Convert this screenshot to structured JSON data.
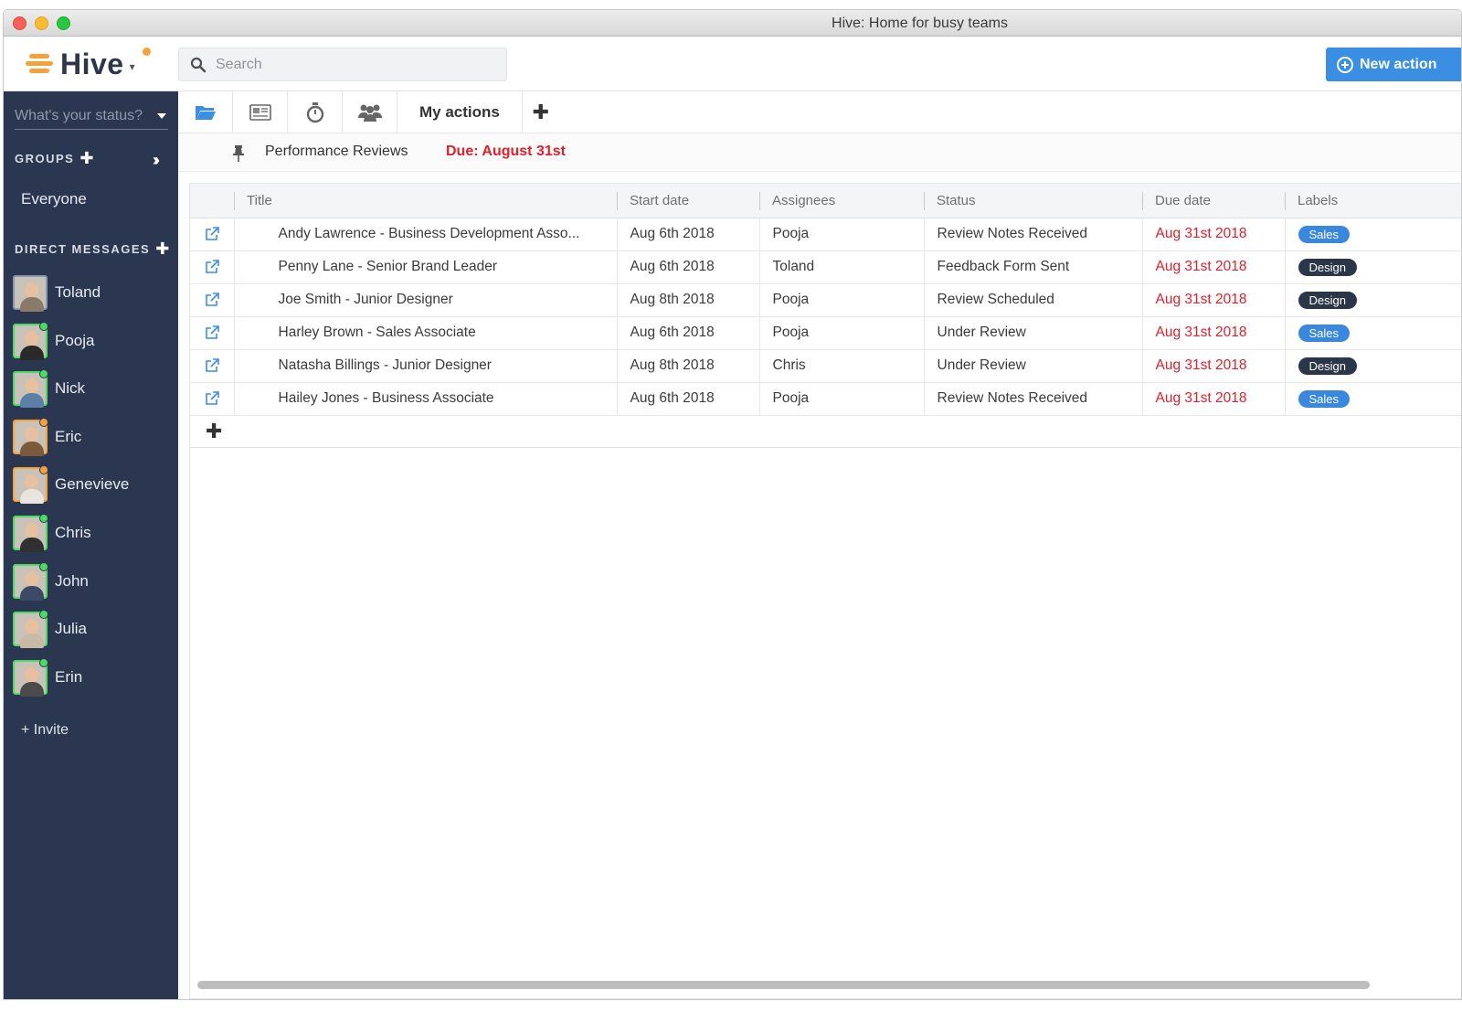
{
  "window": {
    "title": "Hive: Home for busy teams"
  },
  "app": {
    "logo_text": "Hive"
  },
  "search": {
    "placeholder": "Search"
  },
  "toolbar": {
    "new_action_label": "New action"
  },
  "sidebar": {
    "status_placeholder": "What's your status?",
    "groups_heading": "GROUPS",
    "groups": [
      {
        "label": "Everyone"
      }
    ],
    "dm_heading": "DIRECT MESSAGES",
    "direct_messages": [
      {
        "name": "Toland",
        "presence": "none",
        "shirt": "#8a7a6a"
      },
      {
        "name": "Pooja",
        "presence": "online",
        "shirt": "#2a2a2a"
      },
      {
        "name": "Nick",
        "presence": "online",
        "shirt": "#5c7fa8"
      },
      {
        "name": "Eric",
        "presence": "away",
        "shirt": "#7a5a3a"
      },
      {
        "name": "Genevieve",
        "presence": "away",
        "shirt": "#e9e4dd"
      },
      {
        "name": "Chris",
        "presence": "online",
        "shirt": "#303030"
      },
      {
        "name": "John",
        "presence": "online",
        "shirt": "#3b4a66"
      },
      {
        "name": "Julia",
        "presence": "online",
        "shirt": "#c9b9a5"
      },
      {
        "name": "Erin",
        "presence": "online",
        "shirt": "#4b4b4b"
      }
    ],
    "invite_label": "+ Invite"
  },
  "tabs": {
    "icons": [
      "folder-icon",
      "newspaper-icon",
      "timer-icon",
      "team-icon"
    ],
    "my_actions_label": "My actions"
  },
  "pinned": {
    "title": "Performance Reviews",
    "due": "Due: August 31st"
  },
  "table": {
    "columns": [
      "Title",
      "Start date",
      "Assignees",
      "Status",
      "Due date",
      "Labels"
    ],
    "rows": [
      {
        "title": "Andy Lawrence  - Business Development Asso...",
        "start": "Aug 6th 2018",
        "assignee": "Pooja",
        "status": "Review Notes Received",
        "due": "Aug 31st 2018",
        "label": "Sales"
      },
      {
        "title": "Penny Lane - Senior Brand Leader",
        "start": "Aug 6th 2018",
        "assignee": "Toland",
        "status": "Feedback Form Sent",
        "due": "Aug 31st 2018",
        "label": "Design"
      },
      {
        "title": "Joe Smith - Junior Designer",
        "start": "Aug 8th 2018",
        "assignee": "Pooja",
        "status": "Review Scheduled",
        "due": "Aug 31st 2018",
        "label": "Design"
      },
      {
        "title": "Harley Brown - Sales Associate",
        "start": "Aug 6th 2018",
        "assignee": "Pooja",
        "status": "Under Review",
        "due": "Aug 31st 2018",
        "label": "Sales"
      },
      {
        "title": "Natasha Billings - Junior Designer",
        "start": "Aug 8th 2018",
        "assignee": "Chris",
        "status": "Under Review",
        "due": "Aug 31st 2018",
        "label": "Design"
      },
      {
        "title": "Hailey Jones - Business Associate",
        "start": "Aug 6th 2018",
        "assignee": "Pooja",
        "status": "Review Notes Received",
        "due": "Aug 31st 2018",
        "label": "Sales"
      }
    ]
  },
  "colors": {
    "sidebar": "#2b3750",
    "accent": "#3b8fe3",
    "due_red": "#e0202b",
    "label_sales": "#3a87de",
    "label_design": "#2b3648",
    "presence_online": "#4cd964",
    "presence_away": "#f6a23a"
  }
}
